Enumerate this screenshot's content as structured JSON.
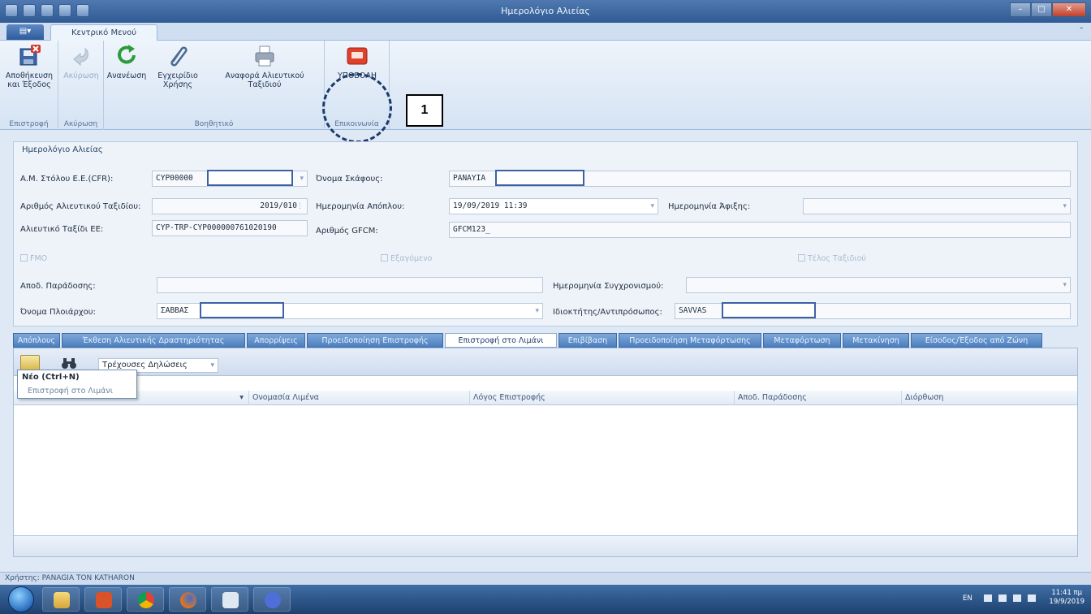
{
  "window": {
    "title": "Ημερολόγιο Αλιείας"
  },
  "ribbon": {
    "app_button": "",
    "tab": "Κεντρικό Μενού",
    "groups": [
      {
        "label": "Επιστροφή",
        "buttons": [
          {
            "label1": "Αποθήκευση",
            "label2": "και Έξοδος",
            "icon": "save-exit-icon"
          }
        ]
      },
      {
        "label": "Ακύρωση",
        "buttons": [
          {
            "label1": "Ακύρωση",
            "label2": "",
            "icon": "undo-icon"
          }
        ]
      },
      {
        "label": "Βοηθητικό",
        "buttons": [
          {
            "label1": "Ανανέωση",
            "label2": "",
            "icon": "refresh-icon"
          },
          {
            "label1": "Εγχειρίδιο",
            "label2": "Χρήσης",
            "icon": "paperclip-icon"
          },
          {
            "label1": "Αναφορά Αλιευτικού",
            "label2": "Ταξιδιού",
            "icon": "printer-icon"
          }
        ]
      },
      {
        "label": "Επικοινωνία",
        "buttons": [
          {
            "label1": "ΥΠΟΒΟΛΗ",
            "label2": "",
            "icon": "submit-icon"
          }
        ]
      }
    ],
    "callout": "1"
  },
  "form": {
    "title": "Ημερολόγιο Αλιείας",
    "cfr_label": "Α.Μ. Στόλου Ε.Ε.(CFR):",
    "cfr_value": "CYP00000",
    "vessel_label": "Όνομα Σκάφους:",
    "vessel_value": "PANAYIA",
    "trip_no_label": "Αριθμός Αλιευτικού Ταξιδίου:",
    "trip_no_value": "2019/010",
    "departure_label": "Ημερομηνία Απόπλου:",
    "departure_value": "19/09/2019 11:39",
    "arrival_label": "Ημερομηνία Άφιξης:",
    "arrival_value": "",
    "eu_trip_label": "Αλιευτικό Ταξίδι ΕΕ:",
    "eu_trip_value": "CYP-TRP-CYP000000761020190",
    "gfcm_label": "Αριθμός GFCM:",
    "gfcm_value": "GFCM123_",
    "chk_fmo": "FMO",
    "chk_export": "Εξαγόμενο",
    "chk_trip_end": "Τέλος Ταξιδιού",
    "delivery_label": "Αποδ. Παράδοσης:",
    "delivery_value": "",
    "sync_label": "Ημερομηνία Συγχρονισμού:",
    "sync_value": "",
    "master_label": "Όνομα Πλοιάρχου:",
    "master_value": "ΣΑΒΒΑΣ",
    "owner_label": "Ιδιοκτήτης/Αντιπρόσωπος:",
    "owner_value": "SAVVAS"
  },
  "tabs": [
    "Απόπλους",
    "Έκθεση Αλιευτικής Δραστηριότητας",
    "Απορρίψεις",
    "Προειδοποίηση Επιστροφής",
    "Επιστροφή στο Λιμάνι",
    "Επιβίβαση",
    "Προειδοποίηση Μεταφόρτωσης",
    "Μεταφόρτωση",
    "Μετακίνηση",
    "Είσοδος/Έξοδος από Ζώνη"
  ],
  "grid": {
    "filter_value": "Τρέχουσες Δηλώσεις",
    "tooltip_title": "Νέο (Ctrl+N)",
    "tooltip_sub": "Επιστροφή στο Λιμάνι",
    "columns": [
      "",
      "Ονομασία Λιμένα",
      "Λόγος Επιστροφής",
      "Αποδ. Παράδοσης",
      "Διόρθωση"
    ]
  },
  "status": {
    "user_label": "Χρήστης: PANAGIA TON KATHARON"
  },
  "taskbar": {
    "lang": "EN",
    "time": "11:41 πμ",
    "date": "19/9/2019",
    "apps": [
      "folder-icon",
      "office-icon",
      "chrome-icon",
      "firefox-icon",
      "anchor-app-icon",
      "vpn-icon"
    ]
  },
  "colors": {
    "accent": "#2f5a93",
    "tab_active": "#ffffff",
    "redact_border": "#3d62a3"
  }
}
